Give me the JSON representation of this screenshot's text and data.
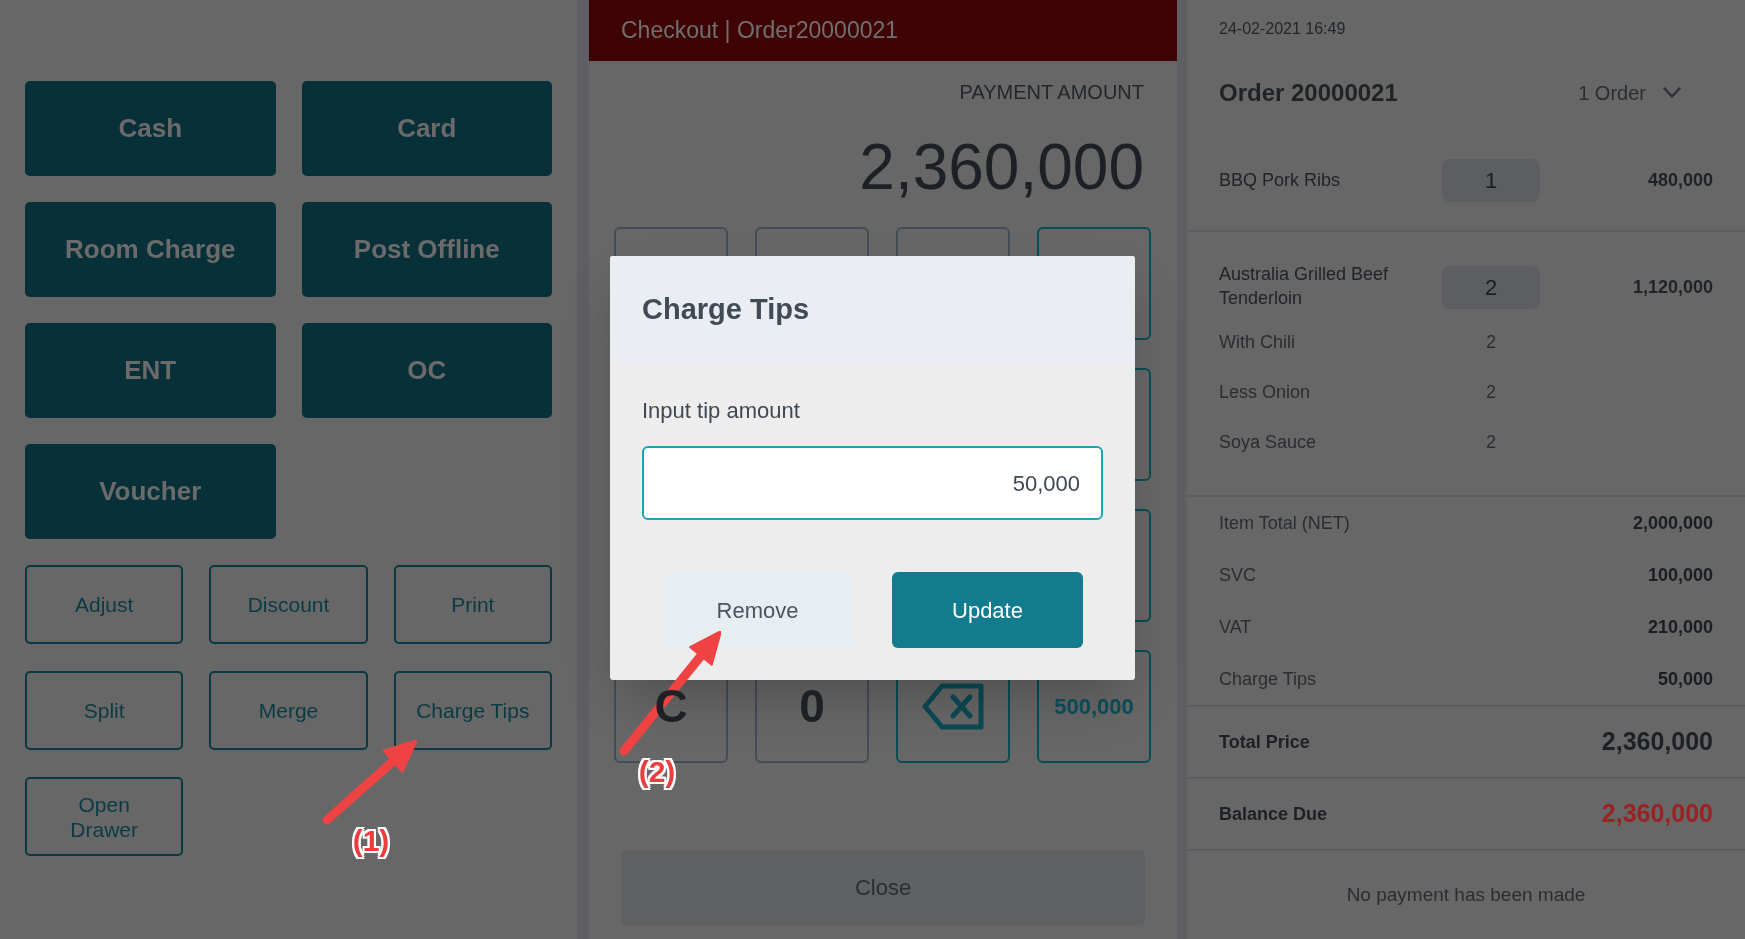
{
  "payment_methods": [
    "Cash",
    "Card",
    "Room Charge",
    "Post Offline",
    "ENT",
    "OC",
    "Voucher"
  ],
  "order_actions": [
    "Adjust",
    "Discount",
    "Print",
    "Split",
    "Merge",
    "Charge Tips",
    "Open Drawer"
  ],
  "checkout": {
    "title": "Checkout | Order20000021",
    "amount_label": "PAYMENT AMOUNT",
    "amount": "2,360,000",
    "keypad": {
      "rows": [
        {
          "keys": [
            {
              "kind": "digit"
            },
            {
              "kind": "digit"
            },
            {
              "kind": "digit"
            },
            {
              "kind": "amount"
            }
          ]
        },
        {
          "keys": [
            {
              "kind": "amount"
            }
          ]
        },
        {
          "keys": [
            {
              "kind": "amount"
            }
          ]
        },
        {
          "keys": [
            {
              "kind": "digit",
              "label": "C"
            },
            {
              "kind": "digit",
              "label": "0"
            },
            {
              "kind": "backspace"
            },
            {
              "kind": "amount",
              "label": "500,000"
            }
          ]
        }
      ]
    },
    "close_button": "Close"
  },
  "dialog": {
    "title": "Charge Tips",
    "field_label": "Input tip amount",
    "tip_amount": {
      "value": "50,000"
    },
    "buttons": [
      {
        "kind": "secondary",
        "label": "Remove"
      },
      {
        "kind": "primary",
        "label": "Update"
      }
    ]
  },
  "order": {
    "timestamp": "24-02-2021 16:49",
    "title": "Order 20000021",
    "order_selector": "1 Order",
    "items": [
      {
        "name": "BBQ Pork Ribs",
        "quantity": "1",
        "price": "480,000"
      },
      {
        "name": "Australia Grilled Beef Tenderloin",
        "quantity": "2",
        "price": "1,120,000",
        "modifiers": [
          {
            "name": "With Chili",
            "quantity": "2"
          },
          {
            "name": "Less Onion",
            "quantity": "2"
          },
          {
            "name": "Soya Sauce",
            "quantity": "2"
          }
        ]
      }
    ],
    "charges": [
      {
        "label": "Item Total (NET)",
        "value": "2,000,000"
      },
      {
        "label": "SVC",
        "value": "100,000"
      },
      {
        "label": "VAT",
        "value": "210,000"
      },
      {
        "label": "Charge Tips",
        "value": "50,000"
      }
    ],
    "totals": [
      {
        "kind": "total",
        "label": "Total Price",
        "value": "2,360,000"
      },
      {
        "kind": "balance",
        "label": "Balance Due",
        "value": "2,360,000"
      }
    ],
    "payment_status": "No payment has been made"
  },
  "annotations": [
    {
      "label": "(1)"
    },
    {
      "label": "(2)"
    }
  ]
}
